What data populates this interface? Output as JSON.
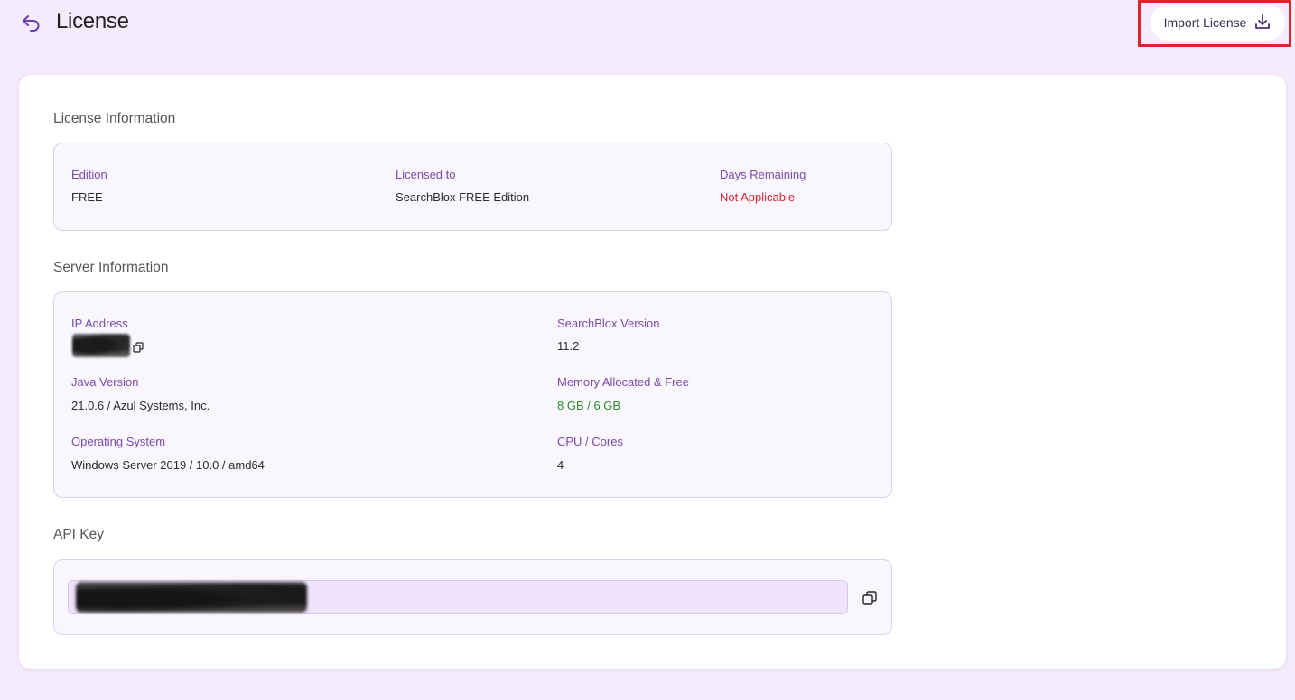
{
  "header": {
    "title": "License",
    "import_button_label": "Import License"
  },
  "license_info": {
    "section_title": "License Information",
    "edition_label": "Edition",
    "edition_value": "FREE",
    "licensed_to_label": "Licensed to",
    "licensed_to_value": "SearchBlox FREE Edition",
    "days_remaining_label": "Days Remaining",
    "days_remaining_value": "Not Applicable"
  },
  "server_info": {
    "section_title": "Server Information",
    "ip_label": "IP Address",
    "version_label": "SearchBlox Version",
    "version_value": "11.2",
    "java_label": "Java Version",
    "java_value": "21.0.6 / Azul Systems, Inc.",
    "memory_label": "Memory Allocated & Free",
    "memory_value": "8 GB / 6 GB",
    "os_label": "Operating System",
    "os_value": "Windows Server 2019 / 10.0 / amd64",
    "cpu_label": "CPU / Cores",
    "cpu_value": "4"
  },
  "api_key": {
    "section_title": "API Key"
  },
  "colors": {
    "accent": "#7b4aa8",
    "background": "#f4ebfc",
    "error": "#d8262e",
    "success": "#2b8a2b",
    "highlight": "#e0202a"
  },
  "icons": {
    "back": "undo-arrow-icon",
    "import": "download-icon",
    "copy": "copy-icon"
  }
}
